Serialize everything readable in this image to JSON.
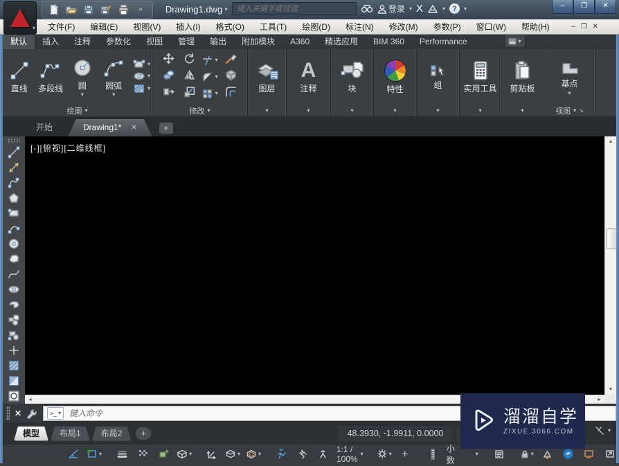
{
  "icons": {
    "dropdown": "▾",
    "flyout_right": "▸",
    "minimize": "–",
    "restore": "❐",
    "close": "✕",
    "plus": "+",
    "hamburger": "≡",
    "scroll_up": "▲",
    "scroll_down": "▼",
    "scroll_left": "◄",
    "scroll_right": "►",
    "qat_more": "»",
    "panel_launcher": "↘",
    "help": "?",
    "prompt": "&gt;_"
  },
  "titlebar": {
    "title": "Drawing1.dwg",
    "search_placeholder": "键入关键字或短语",
    "signin_label": "登录"
  },
  "menubar": {
    "items": [
      "文件(F)",
      "编辑(E)",
      "视图(V)",
      "插入(I)",
      "格式(O)",
      "工具(T)",
      "绘图(D)",
      "标注(N)",
      "修改(M)",
      "参数(P)",
      "窗口(W)",
      "帮助(H)"
    ]
  },
  "ribbon": {
    "tabs": [
      "默认",
      "插入",
      "注释",
      "参数化",
      "视图",
      "管理",
      "输出",
      "附加模块",
      "A360",
      "精选应用",
      "BIM 360",
      "Performance"
    ],
    "draw": {
      "label": "绘图",
      "line": "直线",
      "polyline": "多段线",
      "circle": "圆",
      "arc": "圆弧"
    },
    "modify": {
      "label": "修改"
    },
    "layers": {
      "label": "图层"
    },
    "annotate": {
      "label": "注释",
      "letter": "A"
    },
    "block": {
      "label": "块"
    },
    "properties": {
      "label": "特性"
    },
    "groups": {
      "label": "组"
    },
    "utilities": {
      "label": "实用工具"
    },
    "clipboard": {
      "label": "剪贴板"
    },
    "view": {
      "label": "视图",
      "basepoint": "基点"
    }
  },
  "file_tabs": {
    "start": "开始",
    "drawing": "Drawing1*"
  },
  "canvas": {
    "viewport_label": "[-][俯视][二维线框]"
  },
  "command_line": {
    "placeholder": "键入命令"
  },
  "layout_bar": {
    "model_tab": "模型",
    "layout1_tab": "布局1",
    "layout2_tab": "布局2",
    "coordinates": "48.3930, -1.9911, 0.0000",
    "model_space": "模型"
  },
  "status_bar": {
    "annotation_scale": "1:1 / 100%",
    "units": "小数"
  },
  "watermark": {
    "title": "溜溜自学",
    "subtitle": "ZIXUE.3066.COM"
  },
  "colors": {
    "accent_blue": "#4da0d8",
    "frame_blue": "#5c87bd",
    "watermark_bg": "#20294d",
    "canvas": "#000000"
  }
}
